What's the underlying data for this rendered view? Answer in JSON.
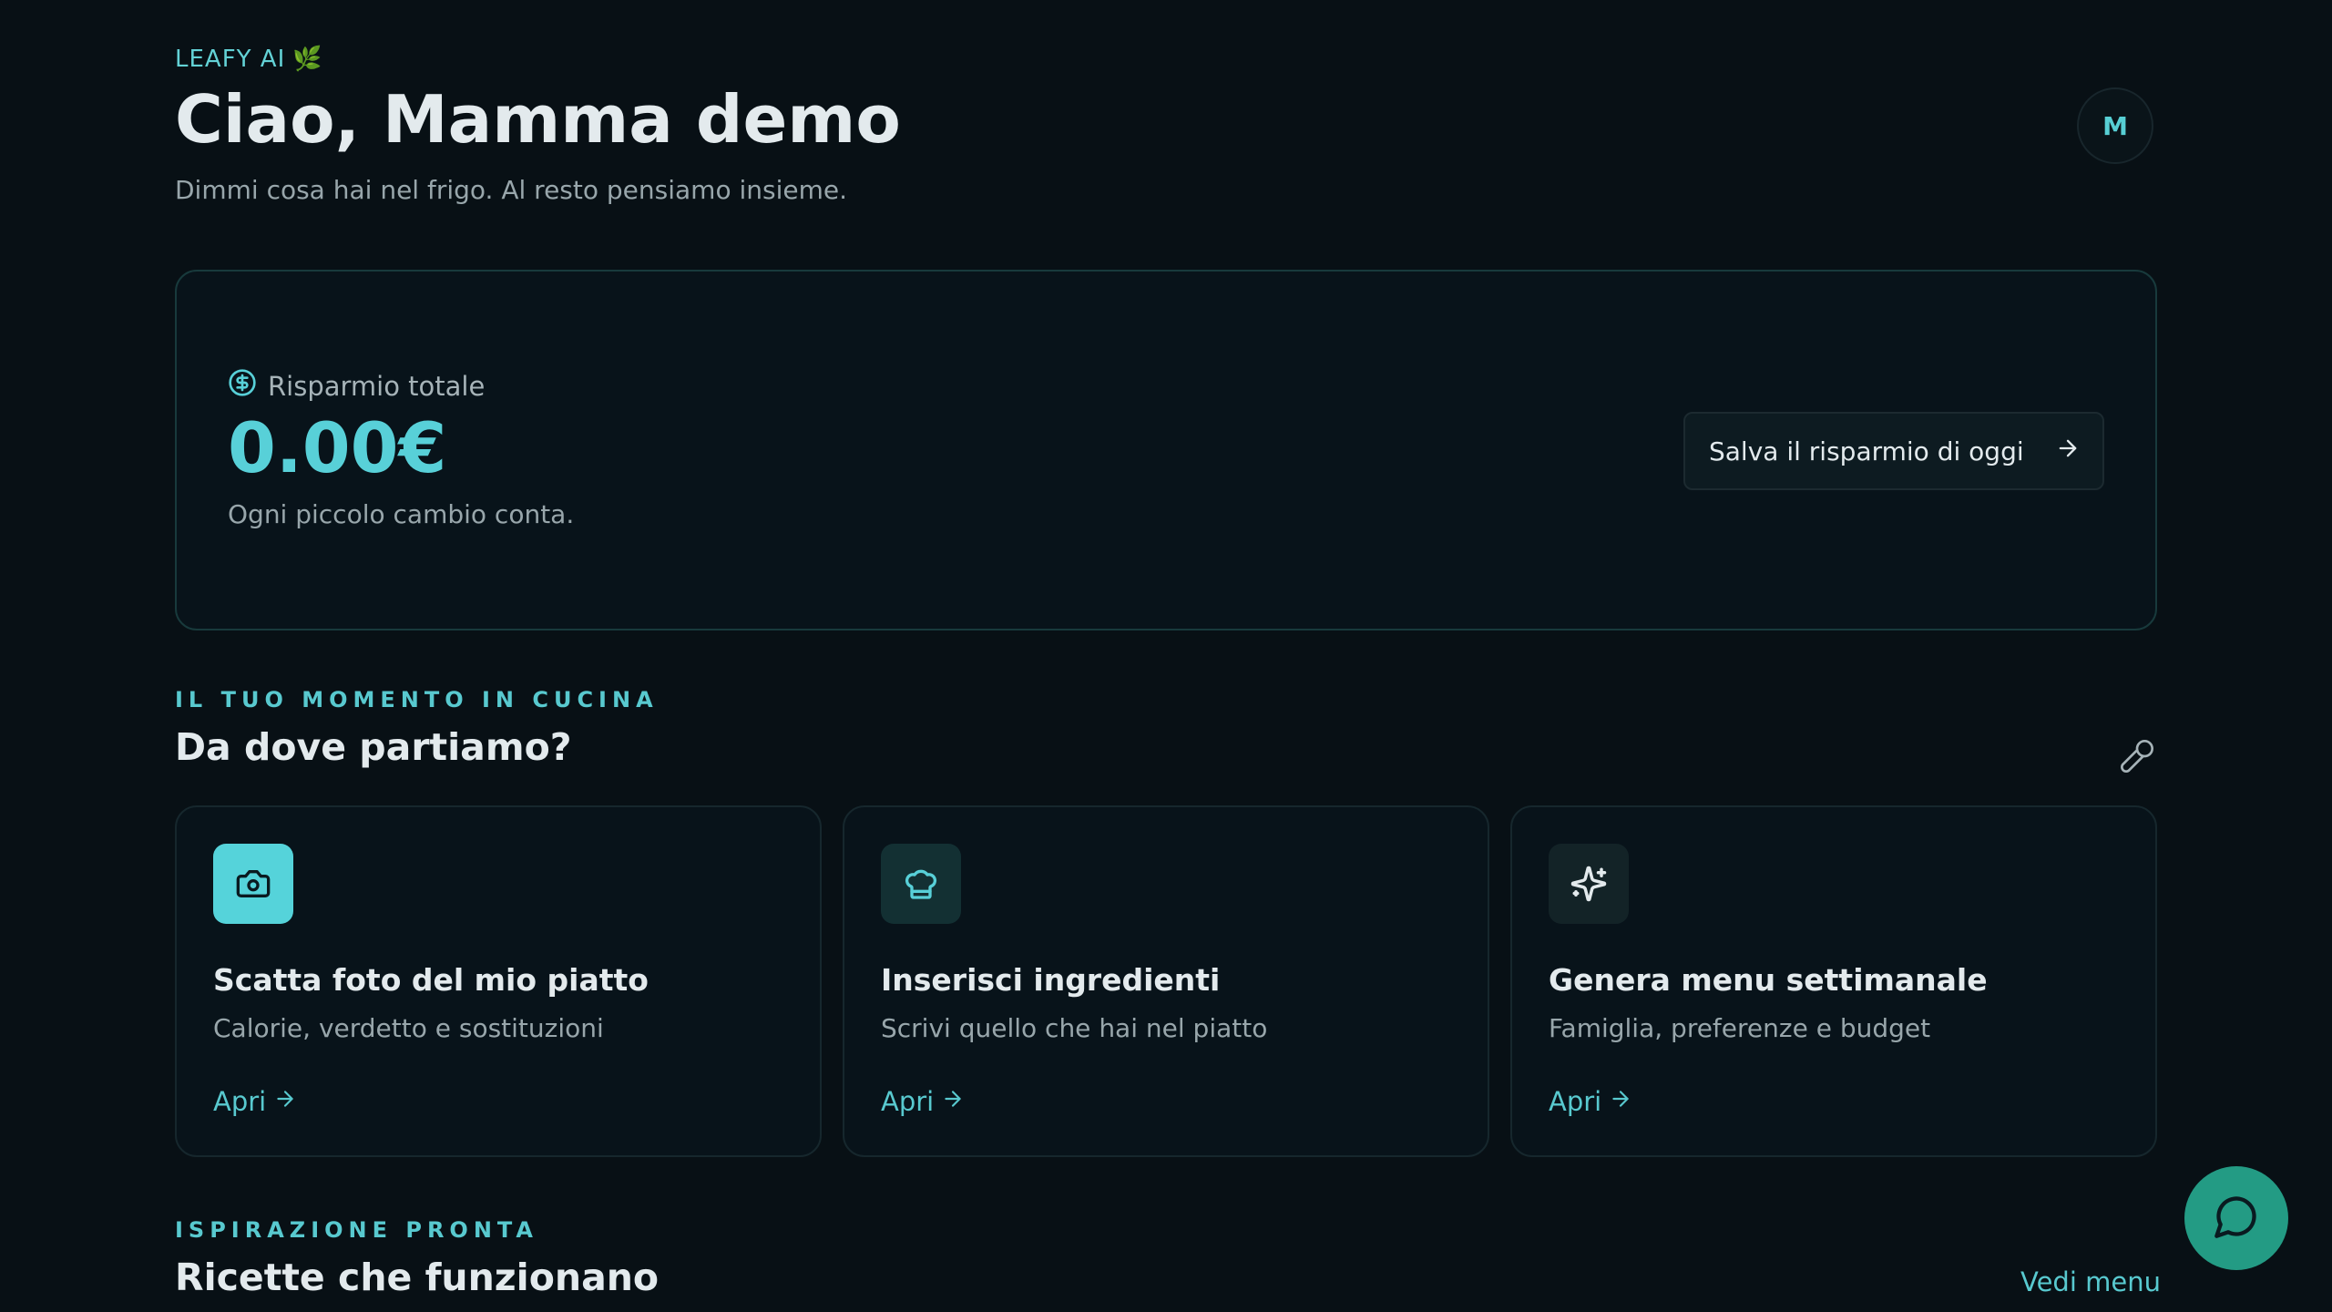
{
  "header": {
    "brand": "LEAFY AI",
    "brand_emoji": "🌿",
    "greeting": "Ciao, Mamma demo",
    "subtitle": "Dimmi cosa hai nel frigo. Al resto pensiamo insieme.",
    "avatar_initial": "M"
  },
  "savings": {
    "label": "Risparmio totale",
    "amount": "0.00€",
    "note": "Ogni piccolo cambio conta.",
    "button_label": "Salva il risparmio di oggi"
  },
  "kitchen": {
    "eyebrow": "IL TUO MOMENTO IN CUCINA",
    "title": "Da dove partiamo?",
    "cards": [
      {
        "title": "Scatta foto del mio piatto",
        "subtitle": "Calorie, verdetto e sostituzioni",
        "link": "Apri",
        "icon": "camera-icon"
      },
      {
        "title": "Inserisci ingredienti",
        "subtitle": "Scrivi quello che hai nel piatto",
        "link": "Apri",
        "icon": "chef-hat-icon"
      },
      {
        "title": "Genera menu settimanale",
        "subtitle": "Famiglia, preferenze e budget",
        "link": "Apri",
        "icon": "sparkles-icon"
      }
    ]
  },
  "recipes": {
    "eyebrow": "ISPIRAZIONE PRONTA",
    "title": "Ricette che funzionano",
    "view_menu": "Vedi menu"
  },
  "colors": {
    "background": "#081015",
    "accent": "#58d0d8",
    "fab": "#239b84"
  }
}
